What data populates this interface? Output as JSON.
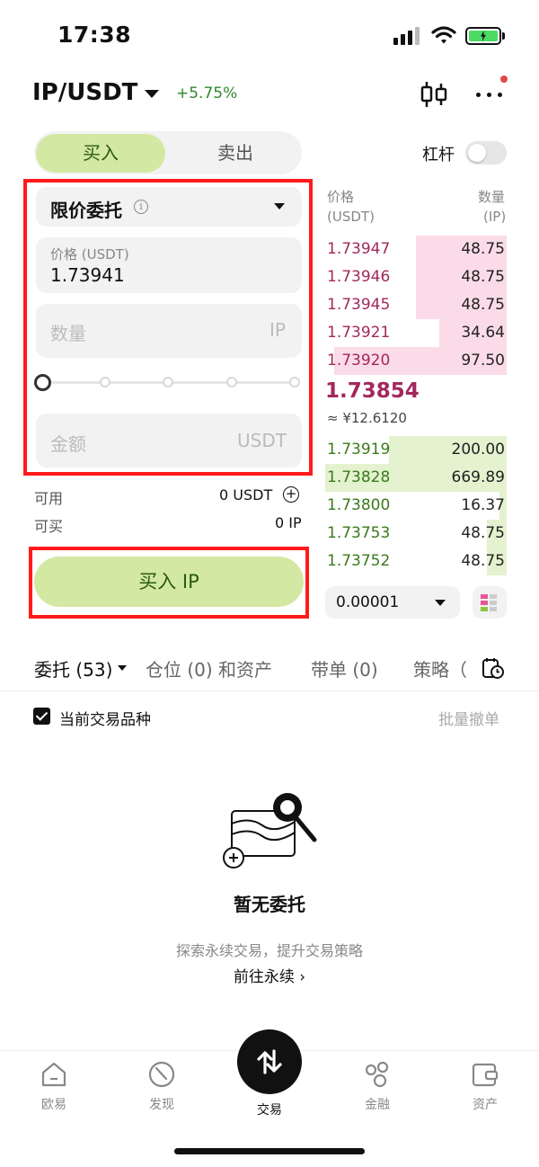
{
  "status_bar": {
    "time": "17:38"
  },
  "header": {
    "pair": "IP/USDT",
    "change": "+5.75%"
  },
  "trade_tabs": {
    "buy": "买入",
    "sell": "卖出"
  },
  "leverage": {
    "label": "杠杆",
    "enabled": false
  },
  "order_form": {
    "order_type": "限价委托",
    "price_label": "价格 (USDT)",
    "price_value": "1.73941",
    "quantity_placeholder": "数量",
    "quantity_unit": "IP",
    "amount_placeholder": "金额",
    "amount_unit": "USDT",
    "slider_percent": 0
  },
  "balance": {
    "available_label": "可用",
    "available_value": "0 USDT",
    "can_buy_label": "可买",
    "can_buy_value": "0 IP"
  },
  "buy_button": "买入 IP",
  "order_book": {
    "price_header": "价格",
    "price_unit": "(USDT)",
    "qty_header": "数量",
    "qty_unit": "(IP)",
    "asks": [
      {
        "price": "1.73947",
        "qty": "48.75",
        "depth": 0.5
      },
      {
        "price": "1.73946",
        "qty": "48.75",
        "depth": 0.5
      },
      {
        "price": "1.73945",
        "qty": "48.75",
        "depth": 0.5
      },
      {
        "price": "1.73921",
        "qty": "34.64",
        "depth": 0.37
      },
      {
        "price": "1.73920",
        "qty": "97.50",
        "depth": 0.95
      }
    ],
    "mid_price": "1.73854",
    "mid_cny": "≈ ¥12.6120",
    "bids": [
      {
        "price": "1.73919",
        "qty": "200.00",
        "depth": 0.65
      },
      {
        "price": "1.73828",
        "qty": "669.89",
        "depth": 1.0
      },
      {
        "price": "1.73800",
        "qty": "16.37",
        "depth": 0.04
      },
      {
        "price": "1.73753",
        "qty": "48.75",
        "depth": 0.11
      },
      {
        "price": "1.73752",
        "qty": "48.75",
        "depth": 0.11
      }
    ],
    "precision": "0.00001"
  },
  "bottom_tabs": {
    "orders": "委托 (53)",
    "positions": "仓位 (0) 和资产",
    "copy_orders": "带单 (0)",
    "strategy": "策略（"
  },
  "filter": {
    "current_pair": "当前交易品种",
    "batch_cancel": "批量撤单"
  },
  "empty_state": {
    "title": "暂无委托",
    "description": "探索永续交易，提升交易策略",
    "link": "前往永续 ›"
  },
  "nav": {
    "home": "欧易",
    "discover": "发现",
    "trade": "交易",
    "finance": "金融",
    "assets": "资产"
  },
  "colors": {
    "buy_green": "#d3e8a2",
    "ask_red": "#a2285c",
    "bid_green": "#3a7a1c",
    "highlight": "#ff1a1a"
  },
  "icons": [
    "signal-icon",
    "wifi-icon",
    "battery-icon",
    "kline-icon",
    "more-icon",
    "info-icon",
    "plus-circle-icon",
    "layout-icon",
    "history-icon",
    "empty-orders-icon",
    "home-icon",
    "discover-icon",
    "trade-icon",
    "finance-icon",
    "wallet-icon"
  ]
}
